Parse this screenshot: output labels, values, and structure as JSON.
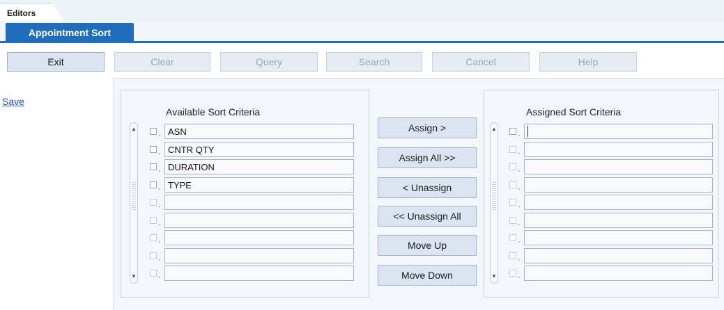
{
  "window": {
    "top_tab": "Editors",
    "active_tab": "Appointment Sort"
  },
  "toolbar": {
    "buttons": [
      {
        "label": "Exit",
        "enabled": true
      },
      {
        "label": "Clear",
        "enabled": false
      },
      {
        "label": "Query",
        "enabled": false
      },
      {
        "label": "Search",
        "enabled": false
      },
      {
        "label": "Cancel",
        "enabled": false
      },
      {
        "label": "Help",
        "enabled": false
      }
    ]
  },
  "side_nav": {
    "save_label": "Save"
  },
  "available": {
    "title": "Available Sort Criteria",
    "rows": [
      "ASN",
      "CNTR QTY",
      "DURATION",
      "TYPE",
      "",
      "",
      "",
      "",
      ""
    ]
  },
  "assigned": {
    "title": "Assigned Sort Criteria",
    "rows": [
      "",
      "",
      "",
      "",
      "",
      "",
      "",
      "",
      ""
    ]
  },
  "move_buttons": {
    "assign": "Assign >",
    "assign_all": "Assign All >>",
    "unassign": "< Unassign",
    "unassign_all": "<< Unassign All",
    "move_up": "Move Up",
    "move_down": "Move Down"
  },
  "colors": {
    "accent": "#1f6dbb",
    "button_bg": "#dbe4f0",
    "panel_bg": "#f3f6fa"
  }
}
